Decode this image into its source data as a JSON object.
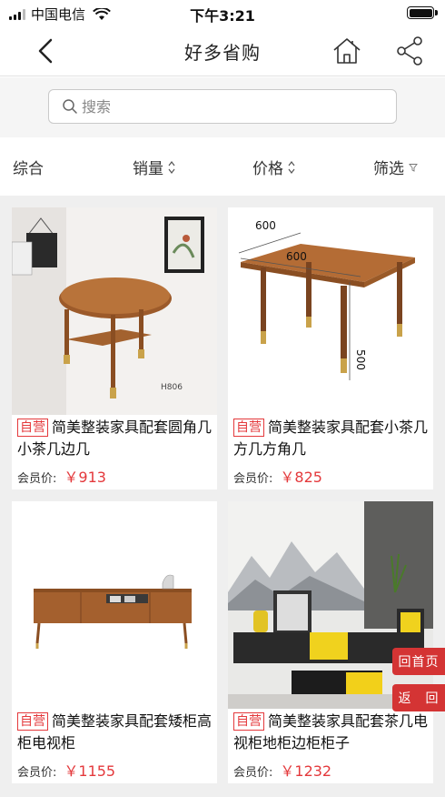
{
  "status_bar": {
    "carrier": "中国电信",
    "time": "下午3:21"
  },
  "nav": {
    "title": "好多省购",
    "icons": [
      "chevron-left-icon",
      "home-icon",
      "share-icon"
    ]
  },
  "search": {
    "placeholder": "搜索",
    "value": ""
  },
  "sort": {
    "items": [
      {
        "label": "综合"
      },
      {
        "label": "销量"
      },
      {
        "label": "价格"
      },
      {
        "label": "筛选"
      }
    ]
  },
  "products": [
    {
      "tag": "自营",
      "title": "简美整装家具配套圆角几小茶几边几",
      "price_label": "会员价:",
      "price": "￥913",
      "image_text": "H806"
    },
    {
      "tag": "自营",
      "title": "简美整装家具配套小茶几方几方角几",
      "price_label": "会员价:",
      "price": "￥825",
      "image_dims": [
        "600",
        "600",
        "500"
      ]
    },
    {
      "tag": "自营",
      "title": "简美整装家具配套矮柜高柜电视柜",
      "price_label": "会员价:",
      "price": "￥1155"
    },
    {
      "tag": "自营",
      "title": "简美整装家具配套茶几电视柜地柜边柜柜子",
      "price_label": "会员价:",
      "price": "￥1232"
    }
  ],
  "floating": {
    "home_label": "回首页",
    "back_label": "返　回"
  },
  "colors": {
    "accent": "#e4393c",
    "float_button": "#d43434",
    "grid_background": "#efefef"
  }
}
